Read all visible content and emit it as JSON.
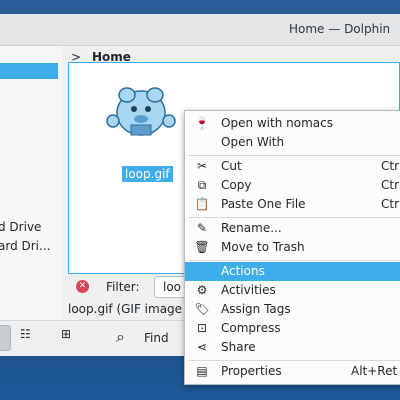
{
  "window": {
    "title": "Home — Dolphin"
  },
  "sidebar": {
    "items": [
      {
        "label": "d Drive"
      },
      {
        "label": "ard Dri..."
      }
    ]
  },
  "breadcrumb": {
    "chevron": ">",
    "current": "Home"
  },
  "file": {
    "name": "loop.gif"
  },
  "filter": {
    "label": "Filter:",
    "value": "loo"
  },
  "status": {
    "text": "loop.gif (GIF image"
  },
  "toolbar": {
    "find_label": "Find"
  },
  "context_menu": {
    "items": [
      {
        "icon": "nomacs-icon",
        "glyph": "🍷",
        "label": "Open with nomacs",
        "shortcut": ""
      },
      {
        "icon": "",
        "glyph": "",
        "label": "Open With",
        "shortcut": ""
      },
      {
        "icon": "cut-icon",
        "glyph": "✂",
        "label": "Cut",
        "shortcut": "Ctr"
      },
      {
        "icon": "copy-icon",
        "glyph": "⧉",
        "label": "Copy",
        "shortcut": "Ctr"
      },
      {
        "icon": "paste-icon",
        "glyph": "📋",
        "label": "Paste One File",
        "shortcut": "Ctr"
      },
      {
        "icon": "rename-icon",
        "glyph": "✎",
        "label": "Rename...",
        "shortcut": ""
      },
      {
        "icon": "trash-icon",
        "glyph": "🗑",
        "label": "Move to Trash",
        "shortcut": ""
      },
      {
        "icon": "",
        "glyph": "",
        "label": "Actions",
        "shortcut": ""
      },
      {
        "icon": "activities-icon",
        "glyph": "⚙",
        "label": "Activities",
        "shortcut": ""
      },
      {
        "icon": "tag-icon",
        "glyph": "🏷",
        "label": "Assign Tags",
        "shortcut": ""
      },
      {
        "icon": "compress-icon",
        "glyph": "⊡",
        "label": "Compress",
        "shortcut": ""
      },
      {
        "icon": "share-icon",
        "glyph": "⋖",
        "label": "Share",
        "shortcut": ""
      },
      {
        "icon": "properties-icon",
        "glyph": "▤",
        "label": "Properties",
        "shortcut": "Alt+Ret"
      }
    ]
  },
  "colors": {
    "accent": "#3daee9",
    "menu_bg": "#fcfcfc",
    "desktop": "#1f4f88"
  }
}
